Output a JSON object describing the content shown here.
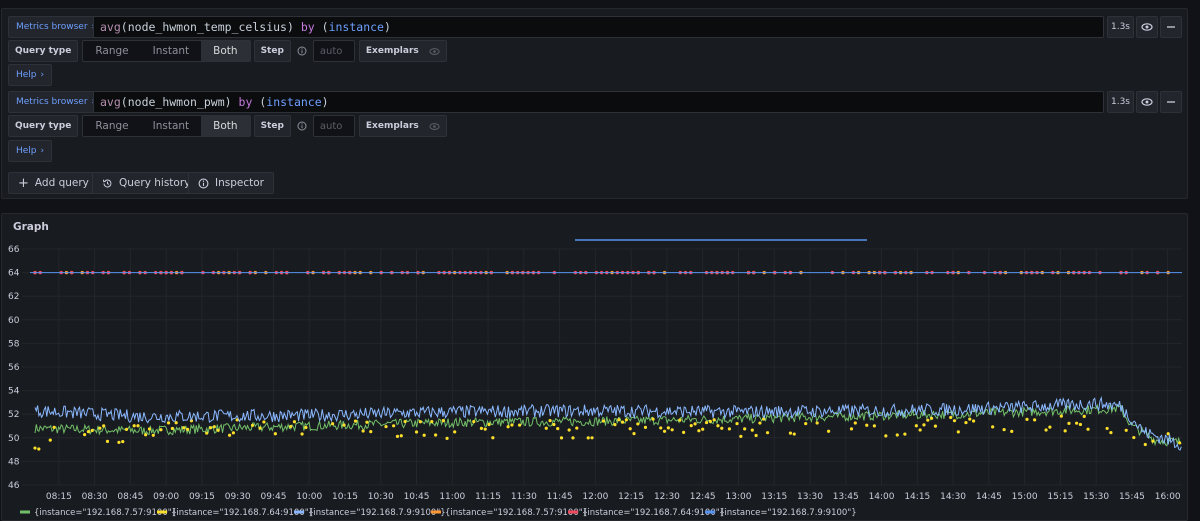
{
  "queries": [
    {
      "metrics_browser_label": "Metrics browser",
      "expr": {
        "fn": "avg",
        "metric": "node_hwmon_temp_celsius",
        "kw": "by",
        "label": "instance"
      },
      "duration": "1.3s",
      "query_type_label": "Query type",
      "options": [
        "Range",
        "Instant",
        "Both"
      ],
      "selected": "Both",
      "step_label": "Step",
      "step_placeholder": "auto",
      "exemplars_label": "Exemplars",
      "help_label": "Help"
    },
    {
      "metrics_browser_label": "Metrics browser",
      "expr": {
        "fn": "avg",
        "metric": "node_hwmon_pwm",
        "kw": "by",
        "label": "instance"
      },
      "duration": "1.3s",
      "query_type_label": "Query type",
      "options": [
        "Range",
        "Instant",
        "Both"
      ],
      "selected": "Both",
      "step_label": "Step",
      "step_placeholder": "auto",
      "exemplars_label": "Exemplars",
      "help_label": "Help"
    }
  ],
  "actions": {
    "add_query": "Add query",
    "query_history": "Query history",
    "inspector": "Inspector"
  },
  "icons": {
    "chevron": "chevron-right-icon",
    "eye": "eye-icon",
    "minus": "minus-icon",
    "info": "info-circle-icon",
    "plus": "plus-icon",
    "history": "history-icon",
    "inspect": "info-circle-icon"
  },
  "graph": {
    "title": "Graph",
    "chart_data": {
      "type": "line",
      "title": "",
      "xlabel": "",
      "ylabel": "",
      "ylim": [
        46,
        66
      ],
      "y_ticks": [
        "66",
        "64",
        "62",
        "60",
        "58",
        "56",
        "54",
        "52",
        "50",
        "48",
        "46"
      ],
      "x_ticks": [
        "08:15",
        "08:30",
        "08:45",
        "09:00",
        "09:15",
        "09:30",
        "09:45",
        "10:00",
        "10:15",
        "10:30",
        "10:45",
        "11:00",
        "11:15",
        "11:30",
        "11:45",
        "12:00",
        "12:15",
        "12:30",
        "12:45",
        "13:00",
        "13:15",
        "13:30",
        "13:45",
        "14:00",
        "14:15",
        "14:30",
        "14:45",
        "15:00",
        "15:15",
        "15:30",
        "15:45",
        "16:00"
      ],
      "x_range_minutes": [
        485,
        966
      ],
      "grid": true,
      "legend_placement": "bottom",
      "series": [
        {
          "name": "{instance=\"192.168.7.57:9100\"}",
          "style": "line",
          "color": "#73bf69",
          "points": [
            [
              485,
              50.8
            ],
            [
              530,
              50.6
            ],
            [
              600,
              51.0
            ],
            [
              660,
              51.3
            ],
            [
              720,
              51.4
            ],
            [
              780,
              51.6
            ],
            [
              840,
              51.9
            ],
            [
              870,
              52.0
            ],
            [
              900,
              52.2
            ],
            [
              930,
              52.4
            ],
            [
              940,
              52.5
            ],
            [
              945,
              51.0
            ],
            [
              955,
              49.8
            ],
            [
              966,
              49.6
            ]
          ]
        },
        {
          "name": "{instance=\"192.168.7.64:9100\"}",
          "style": "points",
          "color": "#fade2a",
          "points": [
            [
              490,
              50.6
            ],
            [
              520,
              50.4
            ],
            [
              560,
              50.8
            ],
            [
              600,
              51.0
            ],
            [
              640,
              50.6
            ],
            [
              680,
              50.8
            ],
            [
              720,
              50.7
            ],
            [
              760,
              50.9
            ],
            [
              800,
              50.8
            ],
            [
              830,
              50.6
            ],
            [
              860,
              51.0
            ],
            [
              900,
              50.9
            ],
            [
              930,
              51.6
            ],
            [
              950,
              50.2
            ],
            [
              966,
              49.8
            ]
          ]
        },
        {
          "name": "{instance=\"192.168.7.9:9100\"}",
          "style": "line",
          "color": "#8ab8ff",
          "points": [
            [
              485,
              52.3
            ],
            [
              530,
              51.8
            ],
            [
              600,
              51.9
            ],
            [
              660,
              52.2
            ],
            [
              720,
              52.3
            ],
            [
              780,
              52.2
            ],
            [
              840,
              52.3
            ],
            [
              870,
              52.4
            ],
            [
              900,
              52.6
            ],
            [
              930,
              52.9
            ],
            [
              940,
              52.7
            ],
            [
              950,
              50.5
            ],
            [
              966,
              49.4
            ]
          ]
        },
        {
          "name": "{instance=\"192.168.7.57:9100\"}",
          "style": "points",
          "color": "#ff9830",
          "value": 64
        },
        {
          "name": "{instance=\"192.168.7.64:9100\"}",
          "style": "points",
          "color": "#f2495c",
          "value": 64
        },
        {
          "name": "{instance=\"192.168.7.9:9100\"}",
          "style": "line",
          "color": "#5794f2",
          "value": 64
        }
      ]
    }
  }
}
